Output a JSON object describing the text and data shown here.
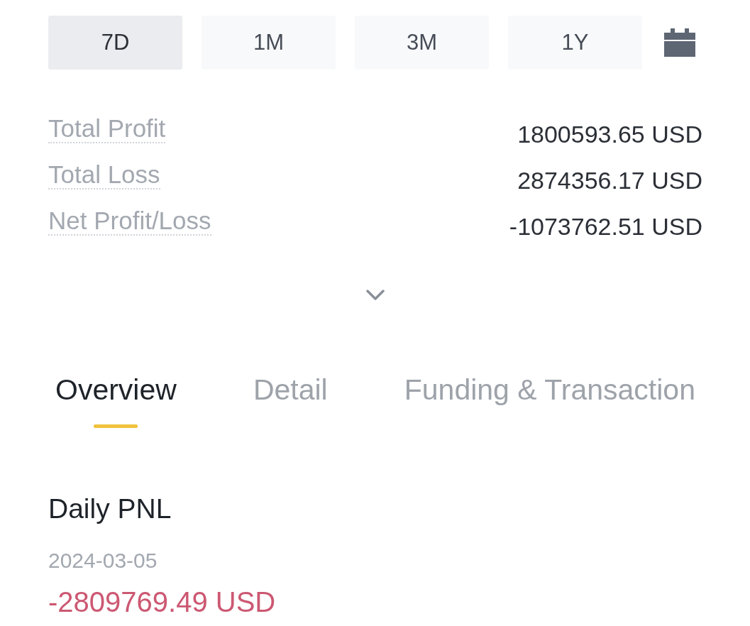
{
  "periods": [
    {
      "label": "7D",
      "selected": true
    },
    {
      "label": "1M",
      "selected": false
    },
    {
      "label": "3M",
      "selected": false
    },
    {
      "label": "1Y",
      "selected": false
    }
  ],
  "stats": [
    {
      "label": "Total Profit",
      "value": "1800593.65 USD"
    },
    {
      "label": "Total Loss",
      "value": "2874356.17 USD"
    },
    {
      "label": "Net Profit/Loss",
      "value": "-1073762.51 USD"
    }
  ],
  "details_toggle": {
    "expanded": false
  },
  "tabs": [
    {
      "label": "Overview",
      "selected": true
    },
    {
      "label": "Detail",
      "selected": false
    },
    {
      "label": "Funding & Transaction",
      "selected": false
    }
  ],
  "daily_pnl": {
    "title": "Daily PNL",
    "date": "2024-03-05",
    "value": "-2809769.49 USD",
    "loss": true
  }
}
